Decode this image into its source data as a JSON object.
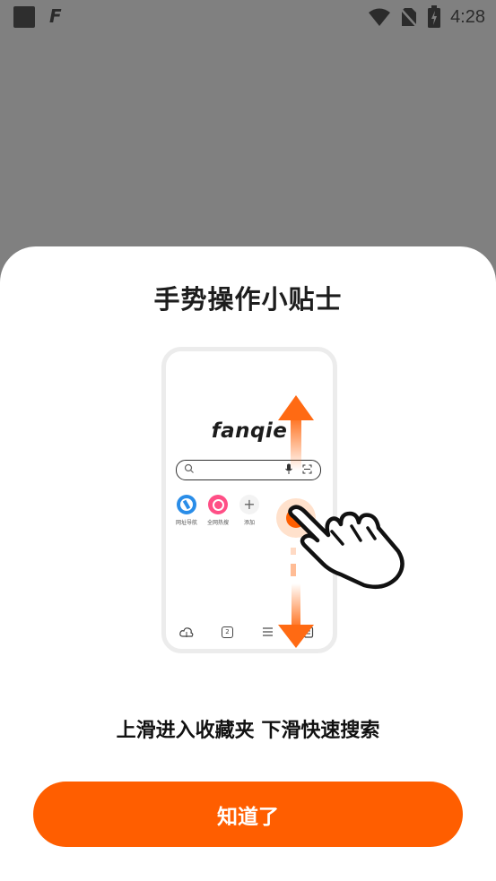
{
  "status_bar": {
    "time": "4:28",
    "icons": [
      "app-square-icon",
      "fanqie-f-icon",
      "wifi-icon",
      "no-sim-icon",
      "battery-charging-icon"
    ],
    "app_letter": "F"
  },
  "sheet": {
    "title": "手势操作小贴士",
    "subtitle": "上滑进入收藏夹  下滑快速搜索",
    "confirm_label": "知道了"
  },
  "illustration": {
    "logo": "fanqie",
    "shortcuts": [
      {
        "label": "网址导航",
        "icon": "compass-icon"
      },
      {
        "label": "全网热搜",
        "icon": "hot-search-icon"
      },
      {
        "label": "添加",
        "icon": "plus-icon"
      }
    ],
    "bottom_nav_icons": [
      "cloud-icon",
      "tabs-icon",
      "menu-icon",
      "bookmark-icon"
    ],
    "tab_count": "2",
    "colors": {
      "accent": "#ff5e00",
      "arrow": "#ff6a13"
    }
  }
}
